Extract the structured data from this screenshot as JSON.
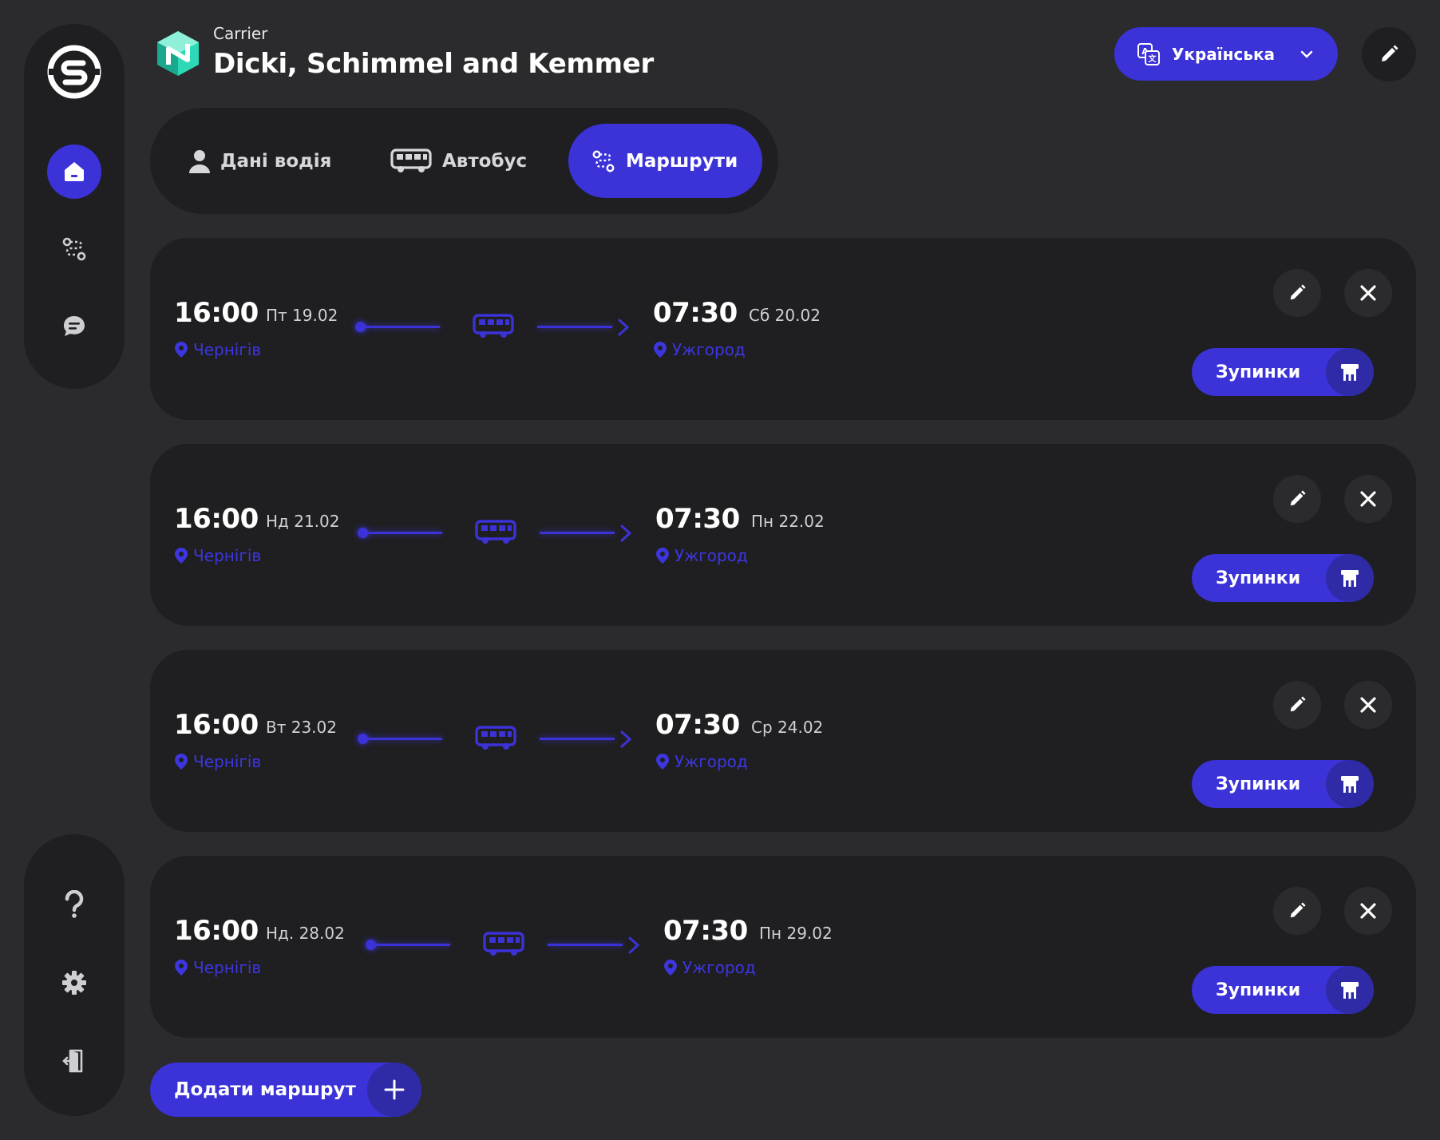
{
  "header": {
    "carrier_label": "Carrier",
    "company_name": "Dicki, Schimmel and Kemmer",
    "language": "Українська"
  },
  "tabs": [
    {
      "label": "Дані водія",
      "active": false
    },
    {
      "label": "Автобус",
      "active": false
    },
    {
      "label": "Маршрути",
      "active": true
    }
  ],
  "routes": [
    {
      "dep_time": "16:00",
      "dep_date": "Пт 19.02",
      "from": "Чернігів",
      "arr_time": "07:30",
      "arr_date": "Сб 20.02",
      "to": "Ужгород",
      "stops_label": "Зупинки"
    },
    {
      "dep_time": "16:00",
      "dep_date": "Нд 21.02",
      "from": "Чернігів",
      "arr_time": "07:30",
      "arr_date": "Пн 22.02",
      "to": "Ужгород",
      "stops_label": "Зупинки"
    },
    {
      "dep_time": "16:00",
      "dep_date": "Вт 23.02",
      "from": "Чернігів",
      "arr_time": "07:30",
      "arr_date": "Ср 24.02",
      "to": "Ужгород",
      "stops_label": "Зупинки"
    },
    {
      "dep_time": "16:00",
      "dep_date": "Нд. 28.02",
      "from": "Чернігів",
      "arr_time": "07:30",
      "arr_date": "Пн 29.02",
      "to": "Ужгород",
      "stops_label": "Зупинки"
    }
  ],
  "add_route_label": "Додати маршрут",
  "colors": {
    "accent": "#3b32d8",
    "background": "#2b2b2d",
    "panel": "#1f1f21"
  }
}
